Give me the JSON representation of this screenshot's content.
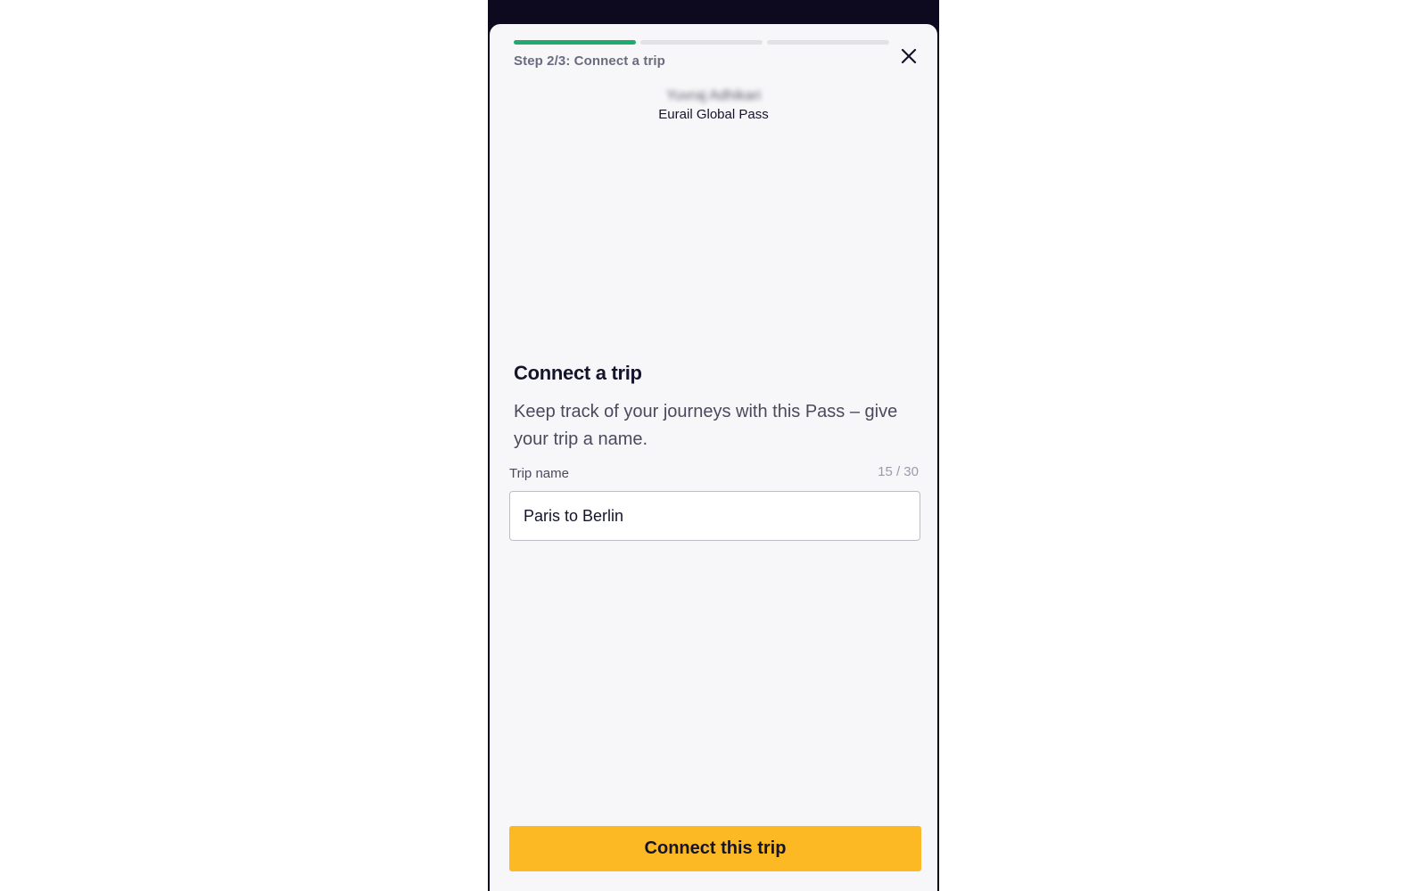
{
  "modal": {
    "progress": {
      "current_step": 2,
      "total_steps": 3
    },
    "step_label": "Step 2/3: Connect a trip",
    "close_icon": "close-icon"
  },
  "pass": {
    "holder_name": "Yuvraj Adhikari",
    "pass_name": "Eurail Global Pass"
  },
  "form": {
    "heading": "Connect a trip",
    "description": "Keep track of your journeys with this Pass – give your trip a name.",
    "trip_name_label": "Trip name",
    "trip_name_value": "Paris to Berlin",
    "char_counter": "15 / 30"
  },
  "actions": {
    "connect_label": "Connect this trip"
  },
  "colors": {
    "progress_done": "#1faa6f",
    "progress_pending": "#e2e2e6",
    "cta_background": "#fdb924",
    "header_background": "#0d0a1f"
  }
}
